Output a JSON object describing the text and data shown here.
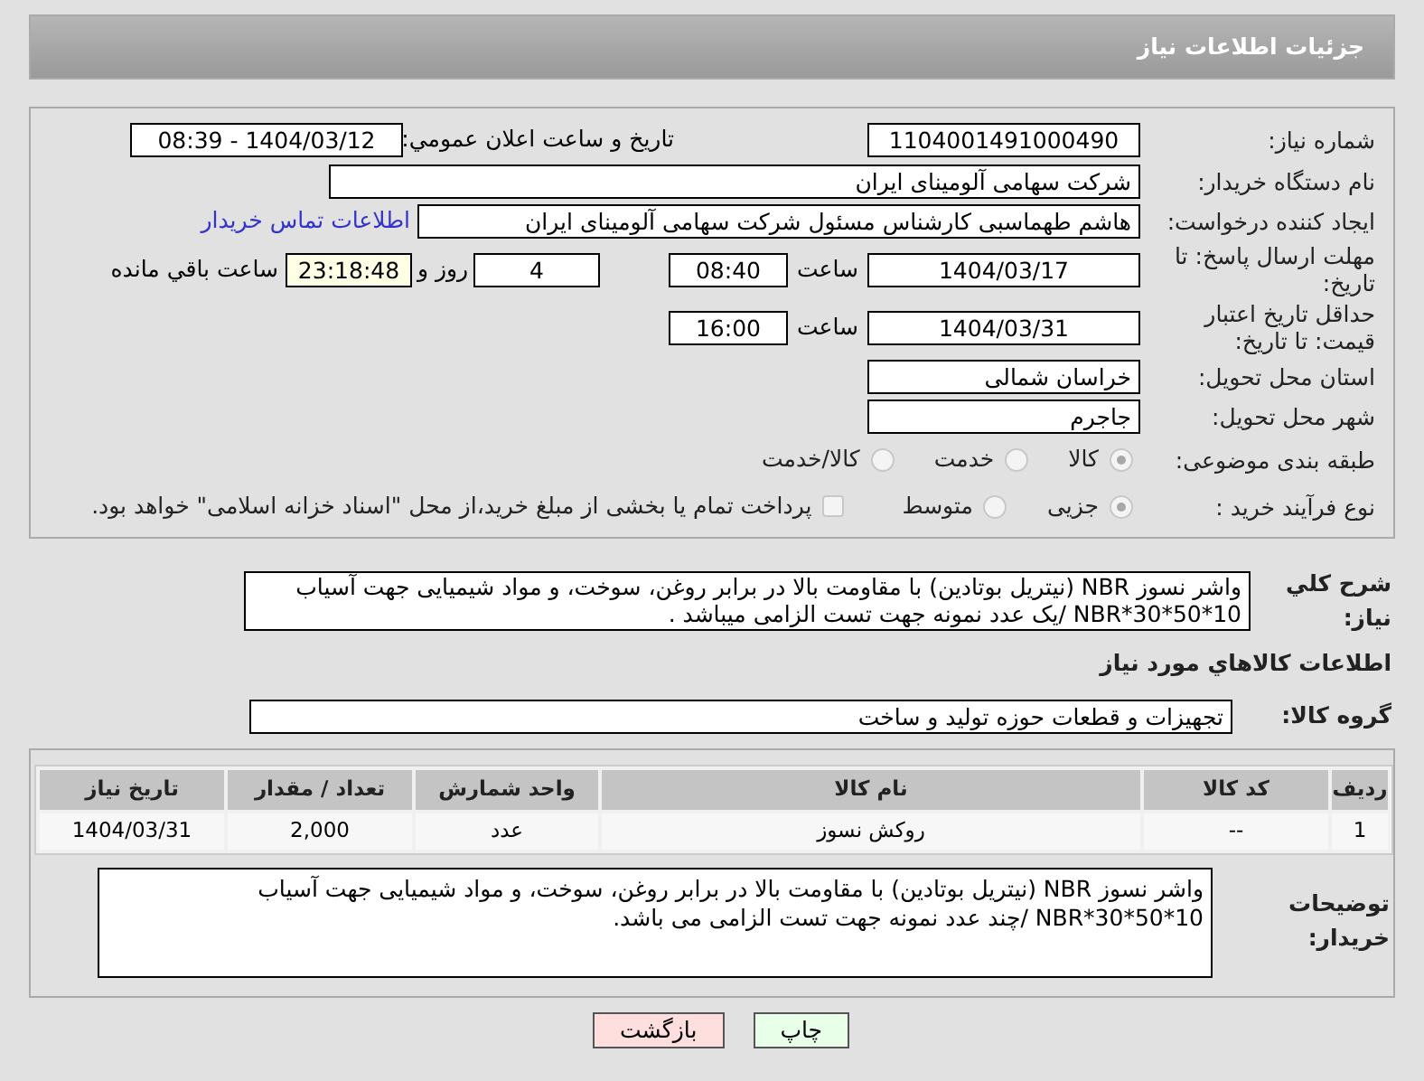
{
  "title": "جزئیات اطلاعات نیاز",
  "need_number": {
    "label": "شماره نیاز:",
    "value": "1104001491000490"
  },
  "announce": {
    "label": "تاریخ و ساعت اعلان عمومي:",
    "value": "1404/03/12 - 08:39"
  },
  "buyer": {
    "label": "نام دستگاه خریدار:",
    "value": "شرکت سهامی آلومینای ایران"
  },
  "requester": {
    "label": "ایجاد کننده درخواست:",
    "value": "هاشم طهماسبی کارشناس مسئول شرکت سهامی آلومینای ایران",
    "contact_link": "اطلاعات تماس خریدار"
  },
  "deadline": {
    "label": "مهلت ارسال پاسخ: تا تاریخ:",
    "date": "1404/03/17",
    "time_label": "ساعت",
    "time": "08:40",
    "days": "4",
    "days_label": "روز و",
    "remaining": "23:18:48",
    "remaining_label": "ساعت باقي مانده"
  },
  "validity": {
    "label": "حداقل تاریخ اعتبار قیمت: تا تاریخ:",
    "date": "1404/03/31",
    "time_label": "ساعت",
    "time": "16:00"
  },
  "province": {
    "label": "استان محل تحویل:",
    "value": "خراسان شمالی"
  },
  "city": {
    "label": "شهر محل تحویل:",
    "value": "جاجرم"
  },
  "category": {
    "label": "طبقه بندی موضوعی:",
    "options": [
      {
        "label": "کالا",
        "selected": true
      },
      {
        "label": "خدمت",
        "selected": false
      },
      {
        "label": "کالا/خدمت",
        "selected": false
      }
    ]
  },
  "process": {
    "label": "نوع فرآیند خرید :",
    "options": [
      {
        "label": "جزیی",
        "selected": true
      },
      {
        "label": "متوسط",
        "selected": false
      }
    ],
    "payment": {
      "checked": false,
      "text": "پرداخت تمام یا بخشی از مبلغ خرید،از محل \"اسناد خزانه اسلامی\" خواهد بود."
    }
  },
  "description": {
    "label": "شرح کلي نياز:",
    "value": "واشر نسوز NBR (نیتریل بوتادین) با مقاومت بالا در برابر روغن، سوخت، و مواد شیمیایی جهت آسیاب 10*50*30*NBR /یک عدد نمونه جهت تست الزامی میباشد ."
  },
  "goods_heading": "اطلاعات کالاهاي مورد نياز",
  "goods_group": {
    "label": "گروه کالا:",
    "value": "تجهیزات و قطعات حوزه تولید و ساخت"
  },
  "table": {
    "columns": [
      "ردیف",
      "کد کالا",
      "نام کالا",
      "واحد شمارش",
      "تعداد / مقدار",
      "تاریخ نیاز"
    ],
    "rows": [
      [
        "1",
        "--",
        "روکش نسوز",
        "عدد",
        "2,000",
        "1404/03/31"
      ]
    ]
  },
  "notes": {
    "label": "توضیحات خریدار:",
    "value": "واشر نسوز NBR (نیتریل بوتادین) با مقاومت بالا در برابر روغن، سوخت، و مواد شیمیایی جهت آسیاب 10*50*30*NBR /چند عدد نمونه جهت تست الزامی می باشد."
  },
  "buttons": [
    {
      "kind": "print",
      "label": "چاپ"
    },
    {
      "kind": "back",
      "label": "بازگشت"
    }
  ]
}
